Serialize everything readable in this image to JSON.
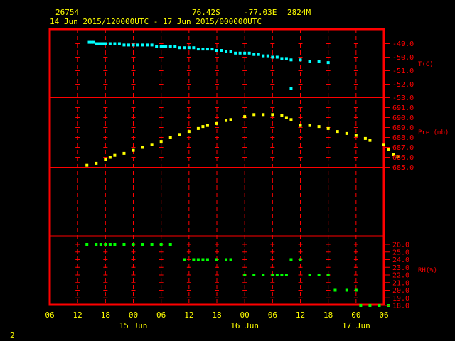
{
  "header": {
    "station_id": "26754",
    "lat": "76.42S",
    "lon": "-77.03E",
    "elevation": "2824M",
    "period": "14 Jun 2015/120000UTC - 17 Jun 2015/000000UTC"
  },
  "page_number": "2",
  "colors": {
    "frame": "#ff0000",
    "grid": "#ff0000",
    "temperature": "#00ffff",
    "pressure": "#ffff00",
    "rh": "#00ff00",
    "text": "#ffff00"
  },
  "chart_data": [
    {
      "type": "scatter",
      "ylabel": "T(C)",
      "ylim": [
        -53.0,
        -48.0
      ],
      "yticks": [
        "-49.0",
        "-50.0",
        "-51.0",
        "-52.0",
        "-53.0"
      ],
      "ytick_values": [
        -49,
        -50,
        -51,
        -52,
        -53
      ],
      "series": [
        {
          "color": "#00ffff",
          "points": [
            [
              14.5,
              -48.9
            ],
            [
              15.0,
              -48.9
            ],
            [
              15.5,
              -48.9
            ],
            [
              16.0,
              -49.0
            ],
            [
              16.5,
              -49.0
            ],
            [
              17.0,
              -49.0
            ],
            [
              17.5,
              -49.0
            ],
            [
              18.0,
              -49.0
            ],
            [
              19.0,
              -49.0
            ],
            [
              20.0,
              -49.0
            ],
            [
              21.0,
              -49.0
            ],
            [
              22.0,
              -49.1
            ],
            [
              23.0,
              -49.1
            ],
            [
              24.0,
              -49.1
            ],
            [
              25.0,
              -49.1
            ],
            [
              26.0,
              -49.1
            ],
            [
              27.0,
              -49.1
            ],
            [
              28.0,
              -49.1
            ],
            [
              29.0,
              -49.2
            ],
            [
              30.0,
              -49.2
            ],
            [
              30.5,
              -49.2
            ],
            [
              31.0,
              -49.2
            ],
            [
              32.0,
              -49.2
            ],
            [
              33.0,
              -49.2
            ],
            [
              34.0,
              -49.3
            ],
            [
              35.0,
              -49.3
            ],
            [
              36.0,
              -49.3
            ],
            [
              37.0,
              -49.3
            ],
            [
              38.0,
              -49.4
            ],
            [
              39.0,
              -49.4
            ],
            [
              40.0,
              -49.4
            ],
            [
              41.0,
              -49.4
            ],
            [
              42.0,
              -49.5
            ],
            [
              43.0,
              -49.5
            ],
            [
              44.0,
              -49.6
            ],
            [
              45.0,
              -49.6
            ],
            [
              46.0,
              -49.7
            ],
            [
              47.0,
              -49.7
            ],
            [
              48.0,
              -49.7
            ],
            [
              49.0,
              -49.7
            ],
            [
              50.0,
              -49.8
            ],
            [
              51.0,
              -49.8
            ],
            [
              52.0,
              -49.9
            ],
            [
              53.0,
              -49.9
            ],
            [
              54.0,
              -50.0
            ],
            [
              55.0,
              -50.0
            ],
            [
              56.0,
              -50.1
            ],
            [
              57.0,
              -50.1
            ],
            [
              58.0,
              -50.2
            ],
            [
              60.0,
              -50.2
            ],
            [
              62.0,
              -50.3
            ],
            [
              64.0,
              -50.3
            ],
            [
              66.0,
              -50.4
            ],
            [
              58.0,
              -52.3
            ]
          ]
        }
      ]
    },
    {
      "type": "scatter",
      "ylabel": "Pre (mb)",
      "ylim": [
        685.0,
        691.0
      ],
      "yticks": [
        "691.0",
        "690.0",
        "689.0",
        "688.0",
        "687.0",
        "686.0",
        "685.0"
      ],
      "ytick_values": [
        691,
        690,
        689,
        688,
        687,
        686,
        685
      ],
      "series": [
        {
          "color": "#ffff00",
          "points": [
            [
              14.0,
              685.2
            ],
            [
              16.0,
              685.4
            ],
            [
              18.0,
              685.8
            ],
            [
              19.0,
              686.0
            ],
            [
              20.0,
              686.2
            ],
            [
              22.0,
              686.4
            ],
            [
              24.0,
              686.7
            ],
            [
              26.0,
              687.0
            ],
            [
              28.0,
              687.3
            ],
            [
              30.0,
              687.6
            ],
            [
              32.0,
              688.0
            ],
            [
              34.0,
              688.3
            ],
            [
              36.0,
              688.6
            ],
            [
              38.0,
              688.9
            ],
            [
              39.0,
              689.1
            ],
            [
              40.0,
              689.2
            ],
            [
              42.0,
              689.4
            ],
            [
              44.0,
              689.7
            ],
            [
              45.0,
              689.8
            ],
            [
              48.0,
              690.1
            ],
            [
              50.0,
              690.3
            ],
            [
              52.0,
              690.3
            ],
            [
              54.0,
              690.3
            ],
            [
              56.0,
              690.2
            ],
            [
              57.0,
              690.0
            ],
            [
              58.0,
              689.8
            ],
            [
              60.0,
              689.2
            ],
            [
              62.0,
              689.2
            ],
            [
              64.0,
              689.1
            ],
            [
              66.0,
              688.9
            ],
            [
              68.0,
              688.6
            ],
            [
              70.0,
              688.4
            ],
            [
              72.0,
              688.2
            ],
            [
              74.0,
              687.9
            ],
            [
              75.0,
              687.7
            ],
            [
              78.0,
              687.3
            ],
            [
              79.0,
              686.8
            ],
            [
              80.0,
              686.3
            ],
            [
              81.0,
              686.1
            ]
          ]
        }
      ]
    },
    {
      "type": "scatter",
      "ylabel": "RH(%)",
      "ylim": [
        18.0,
        26.0
      ],
      "yticks": [
        "26.0",
        "25.0",
        "24.0",
        "23.0",
        "22.0",
        "21.0",
        "20.0",
        "19.0",
        "18.0"
      ],
      "ytick_values": [
        26,
        25,
        24,
        23,
        22,
        21,
        20,
        19,
        18
      ],
      "series": [
        {
          "color": "#00ff00",
          "points": [
            [
              14.0,
              26
            ],
            [
              16.0,
              26
            ],
            [
              17.0,
              26
            ],
            [
              18.0,
              26
            ],
            [
              19.0,
              26
            ],
            [
              20.0,
              26
            ],
            [
              22.0,
              26
            ],
            [
              24.0,
              26
            ],
            [
              26.0,
              26
            ],
            [
              28.0,
              26
            ],
            [
              30.0,
              26
            ],
            [
              32.0,
              26
            ],
            [
              35.0,
              24
            ],
            [
              37.0,
              24
            ],
            [
              38.0,
              24
            ],
            [
              39.0,
              24
            ],
            [
              40.0,
              24
            ],
            [
              42.0,
              24
            ],
            [
              44.0,
              24
            ],
            [
              45.0,
              24
            ],
            [
              48.0,
              22
            ],
            [
              50.0,
              22
            ],
            [
              52.0,
              22
            ],
            [
              54.0,
              22
            ],
            [
              55.0,
              22
            ],
            [
              56.0,
              22
            ],
            [
              57.0,
              22
            ],
            [
              58.0,
              24
            ],
            [
              60.0,
              24
            ],
            [
              62.0,
              22
            ],
            [
              64.0,
              22
            ],
            [
              66.0,
              22
            ],
            [
              67.5,
              20
            ],
            [
              70.0,
              20
            ],
            [
              72.0,
              20
            ],
            [
              73.0,
              18
            ],
            [
              75.0,
              18
            ],
            [
              77.0,
              18
            ],
            [
              79.0,
              18
            ]
          ]
        }
      ]
    }
  ],
  "x_axis": {
    "hours_min": 6,
    "hours_max": 78,
    "tick_labels": [
      "06",
      "12",
      "18",
      "00",
      "06",
      "12",
      "18",
      "00",
      "06",
      "12",
      "18",
      "00",
      "06"
    ],
    "tick_hours": [
      6,
      12,
      18,
      24,
      30,
      36,
      42,
      48,
      54,
      60,
      66,
      72,
      78
    ],
    "date_labels": [
      "15 Jun",
      "16 Jun",
      "17 Jun"
    ],
    "date_hours": [
      24,
      48,
      72
    ]
  }
}
